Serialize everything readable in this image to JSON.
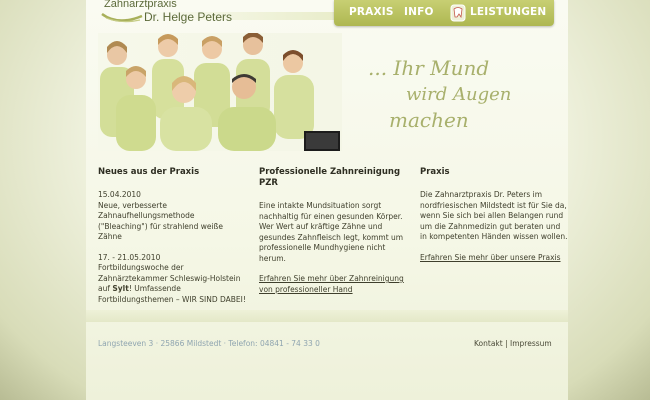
{
  "logo": {
    "line1": "Zahnarztpraxis",
    "line2": "Dr. Helge Peters"
  },
  "nav": {
    "items": [
      {
        "label": "PRAXIS"
      },
      {
        "label": "INFO"
      },
      {
        "label": "LEISTUNGEN"
      }
    ],
    "icon": "tooth-icon"
  },
  "hero": {
    "slogan_line1": "... Ihr Mund",
    "slogan_line2": "wird Augen",
    "slogan_line3": "machen"
  },
  "news": {
    "title": "Neues aus der Praxis",
    "item1_date": "15.04.2010",
    "item1_text": "Neue, verbesserte Zahnaufhellungsmethode (\"Bleaching\") für strahlend weiße Zähne",
    "item2_date": "17. - 21.05.2010",
    "item2_text_a": "Fortbildungswoche der Zahnärztekammer Schleswig-Holstein auf ",
    "item2_bold": "Sylt",
    "item2_text_b": "! Umfassende Fortbildungsthemen – WIR SIND DABEI!"
  },
  "cleaning": {
    "title": "Professionelle Zahnreinigung PZR",
    "body": "Eine intakte Mundsituation sorgt nachhaltig für einen gesunden Körper. Wer Wert auf kräftige Zähne und gesundes Zahnfleisch legt, kommt um professionelle Mundhygiene nicht herum.",
    "link": "Erfahren Sie mehr über Zahnreinigung von professioneller Hand"
  },
  "praxis": {
    "title": "Praxis",
    "body": "Die Zahnarztpraxis Dr. Peters im nordfriesischen Mildstedt ist für Sie da, wenn Sie sich bei allen Belangen rund um die Zahnmedizin gut beraten und in kompetenten Händen wissen wollen.",
    "link": "Erfahren Sie mehr über unsere Praxis"
  },
  "footer": {
    "address": "Langsteeven 3 · 25866 Mildstedt · Telefon: 04841 - 74 33 0",
    "kontakt": "Kontakt",
    "separator": "|",
    "impressum": "Impressum"
  },
  "colors": {
    "nav_bg": "#b8c05f",
    "slogan": "#a8b06c",
    "uniform": "#d6e0a0"
  }
}
